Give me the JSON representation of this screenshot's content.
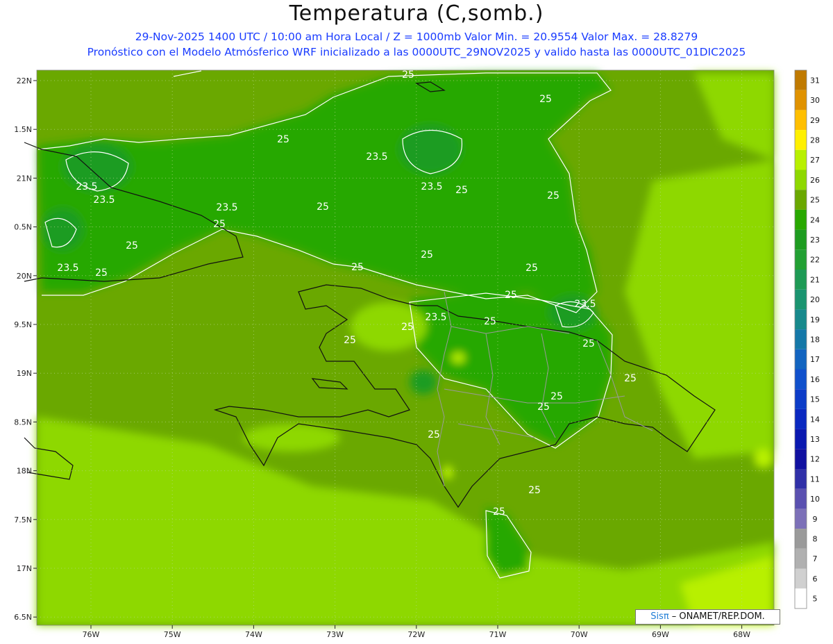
{
  "header": {
    "title": "Temperatura (C,somb.)",
    "line1": "29-Nov-2025 1400 UTC / 10:00 am Hora Local / Z = 1000mb  Valor Min. = 20.9554  Valor Max. = 28.8279",
    "line2": "Pronóstico con el Modelo Atmósferico WRF inicializado a las 0000UTC_29NOV2025 y valido hasta las  0000UTC_01DIC2025"
  },
  "axes": {
    "lat_labels": [
      "22N",
      "1.5N",
      "21N",
      "0.5N",
      "20N",
      "9.5N",
      "19N",
      "8.5N",
      "18N",
      "7.5N",
      "17N",
      "6.5N"
    ],
    "lon_labels": [
      "76W",
      "75W",
      "74W",
      "73W",
      "72W",
      "71W",
      "70W",
      "69W",
      "68W"
    ]
  },
  "colorbar": {
    "labels": [
      "31",
      "30",
      "29",
      "28",
      "27",
      "26",
      "25",
      "24",
      "23",
      "22",
      "21",
      "20",
      "19",
      "18",
      "17",
      "16",
      "15",
      "14",
      "13",
      "12",
      "11",
      "10",
      "9",
      "8",
      "7",
      "6",
      "5"
    ],
    "colors": [
      "#c07a00",
      "#e09200",
      "#ffbf00",
      "#fff000",
      "#b8f000",
      "#8ed800",
      "#6aa800",
      "#28a800",
      "#1e9c20",
      "#22a033",
      "#1e9a55",
      "#1a9470",
      "#17898c",
      "#1478a8",
      "#1264c0",
      "#1050cc",
      "#0c3cc8",
      "#0a28c0",
      "#0a18b0",
      "#1010a0",
      "#3030a8",
      "#5a50b0",
      "#7c70b8",
      "#9a9a9a",
      "#b0b0b0",
      "#d0d0d0",
      "#ffffff"
    ]
  },
  "contour_labels": [
    {
      "text": "25"
    },
    {
      "text": "25"
    },
    {
      "text": "25"
    },
    {
      "text": "23.5"
    },
    {
      "text": "23.5"
    },
    {
      "text": "25"
    },
    {
      "text": "23.5"
    },
    {
      "text": "25"
    },
    {
      "text": "25"
    },
    {
      "text": "23.5"
    },
    {
      "text": "25"
    },
    {
      "text": "23.5"
    },
    {
      "text": "25"
    },
    {
      "text": "25"
    },
    {
      "text": "25"
    },
    {
      "text": "25"
    },
    {
      "text": "25"
    },
    {
      "text": "25"
    },
    {
      "text": "23.5"
    },
    {
      "text": "25"
    },
    {
      "text": "23.5"
    },
    {
      "text": "25"
    },
    {
      "text": "25"
    },
    {
      "text": "25"
    },
    {
      "text": "23.5"
    },
    {
      "text": "25"
    },
    {
      "text": "25"
    },
    {
      "text": "25"
    },
    {
      "text": "25"
    },
    {
      "text": "25"
    },
    {
      "text": "25"
    }
  ],
  "credit": {
    "brand": "Sisπ",
    "text": " – ONAMET/REP.DOM."
  }
}
